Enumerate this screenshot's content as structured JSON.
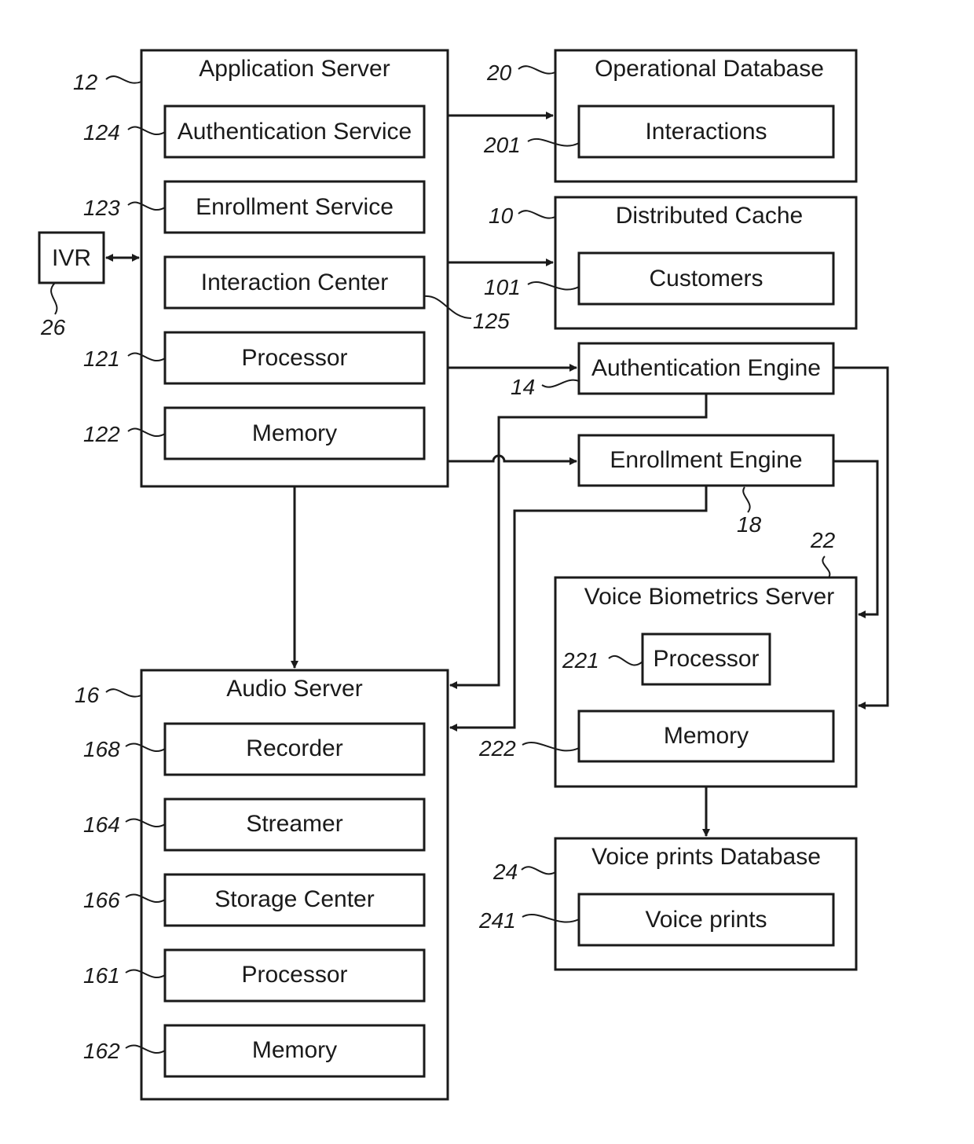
{
  "application_server": {
    "title": "Application Server",
    "ref": "12",
    "items": [
      {
        "label": "Authentication Service",
        "ref": "124"
      },
      {
        "label": "Enrollment Service",
        "ref": "123"
      },
      {
        "label": "Interaction Center",
        "ref": "125"
      },
      {
        "label": "Processor",
        "ref": "121"
      },
      {
        "label": "Memory",
        "ref": "122"
      }
    ]
  },
  "ivr": {
    "label": "IVR",
    "ref": "26"
  },
  "operational_database": {
    "title": "Operational Database",
    "ref": "20",
    "item": {
      "label": "Interactions",
      "ref": "201"
    }
  },
  "distributed_cache": {
    "title": "Distributed Cache",
    "ref": "10",
    "item": {
      "label": "Customers",
      "ref": "101"
    }
  },
  "authentication_engine": {
    "label": "Authentication Engine",
    "ref": "14"
  },
  "enrollment_engine": {
    "label": "Enrollment Engine",
    "ref": "18"
  },
  "voice_biometrics_server": {
    "title": "Voice Biometrics Server",
    "ref": "22",
    "items": [
      {
        "label": "Processor",
        "ref": "221"
      },
      {
        "label": "Memory",
        "ref": "222"
      }
    ]
  },
  "voice_prints_database": {
    "title": "Voice prints Database",
    "ref": "24",
    "item": {
      "label": "Voice prints",
      "ref": "241"
    }
  },
  "audio_server": {
    "title": "Audio Server",
    "ref": "16",
    "items": [
      {
        "label": "Recorder",
        "ref": "168"
      },
      {
        "label": "Streamer",
        "ref": "164"
      },
      {
        "label": "Storage Center",
        "ref": "166"
      },
      {
        "label": "Processor",
        "ref": "161"
      },
      {
        "label": "Memory",
        "ref": "162"
      }
    ]
  }
}
